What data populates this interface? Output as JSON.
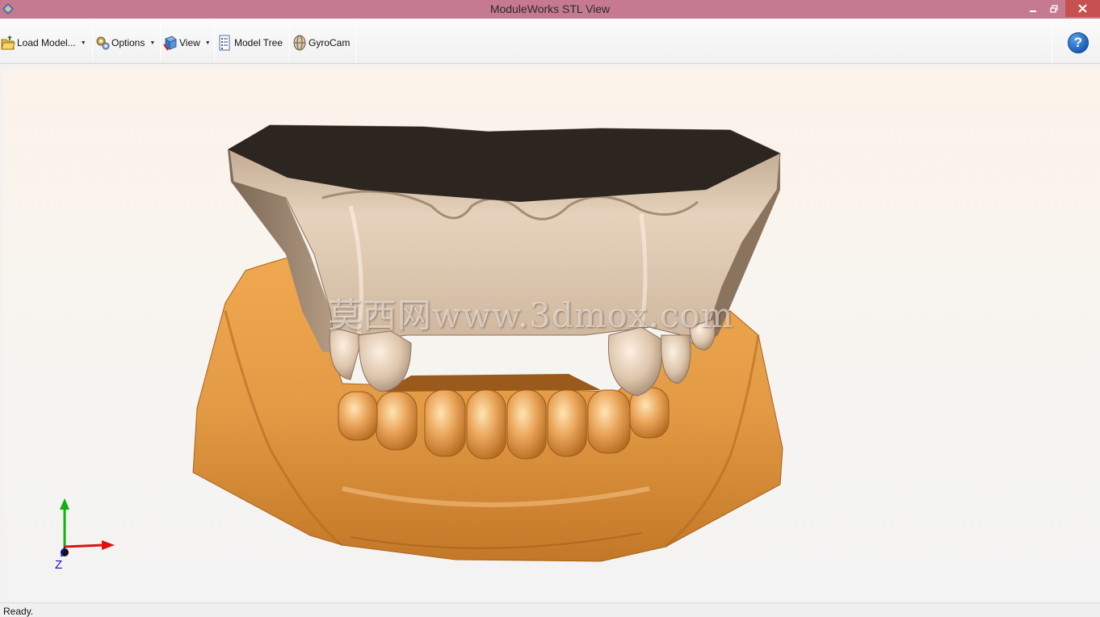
{
  "window": {
    "title": "ModuleWorks STL View",
    "app_icon": "moduleworks-logo-icon",
    "controls": [
      "minimize-icon",
      "restore-icon",
      "close-icon"
    ]
  },
  "toolbar": {
    "items": [
      {
        "label": "Load Model...",
        "icon": "folder-open-icon",
        "has_dropdown": true
      },
      {
        "label": "Options",
        "icon": "gears-icon",
        "has_dropdown": true
      },
      {
        "label": "View",
        "icon": "cube-view-icon",
        "has_dropdown": true
      },
      {
        "label": "Model Tree",
        "icon": "tree-list-icon",
        "has_dropdown": false
      },
      {
        "label": "GyroCam",
        "icon": "gyrocam-icon",
        "has_dropdown": false
      }
    ],
    "help_glyph": "?",
    "help_icon": "help-icon"
  },
  "viewport": {
    "watermark": "莫西网www.3dmox.com",
    "axis_label_z": "Z",
    "colors": {
      "upper_model": "#d8bfa6",
      "upper_base_top": "#2d2520",
      "lower_model": "#e39a45",
      "axis_x": "#e01010",
      "axis_y": "#10b010",
      "axis_z": "#1010c0"
    }
  },
  "status": {
    "text": "Ready."
  }
}
